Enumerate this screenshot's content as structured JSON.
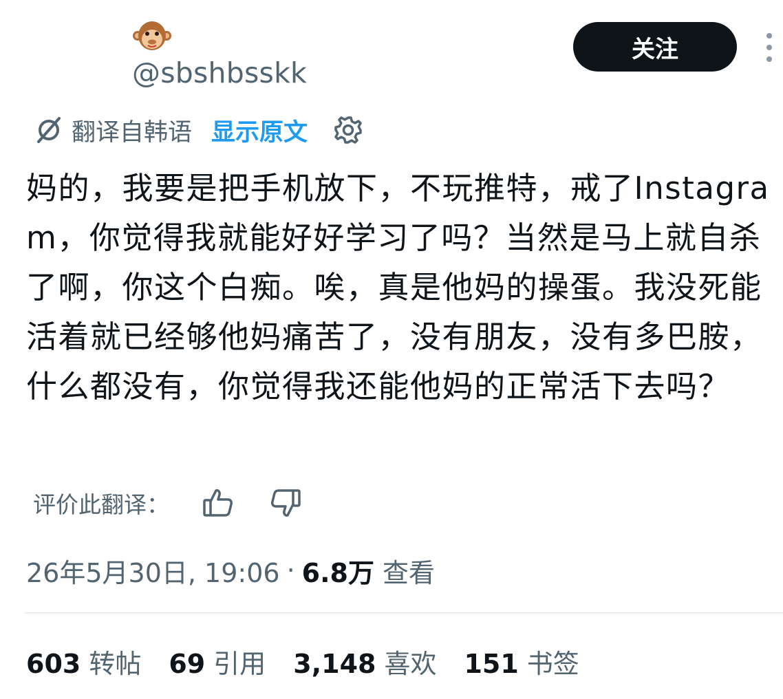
{
  "header": {
    "avatar_icon": "monkey-face-emoji",
    "handle": "@sbshbsskk",
    "follow_label": "关注",
    "more_icon": "more-vertical-icon"
  },
  "translation": {
    "translated_from": "翻译自韩语",
    "show_original": "显示原文",
    "settings_icon": "gear-icon"
  },
  "tweet": {
    "text": "妈的，我要是把手机放下，不玩推特，戒了Instagram，你觉得我就能好好学习了吗？当然是马上就自杀了啊，你这个白痴。唉，真是他妈的操蛋。我没死能活着就已经够他妈痛苦了，没有朋友，没有多巴胺，什么都没有，你觉得我还能他妈的正常活下去吗？"
  },
  "rate": {
    "label": "评价此翻译：",
    "thumbs_up_icon": "thumbs-up-icon",
    "thumbs_down_icon": "thumbs-down-icon"
  },
  "meta": {
    "datetime": "26年5月30日, 19:06",
    "separator": "·",
    "views_count": "6.8万",
    "views_label": "查看"
  },
  "stats": [
    {
      "count": "603",
      "label": "转帖"
    },
    {
      "count": "69",
      "label": "引用"
    },
    {
      "count": "3,148",
      "label": "喜欢"
    },
    {
      "count": "151",
      "label": "书签"
    }
  ],
  "colors": {
    "accent": "#1d9bf0",
    "primary_text": "#0f1419",
    "secondary_text": "#536471",
    "button_bg": "#0f1419"
  }
}
